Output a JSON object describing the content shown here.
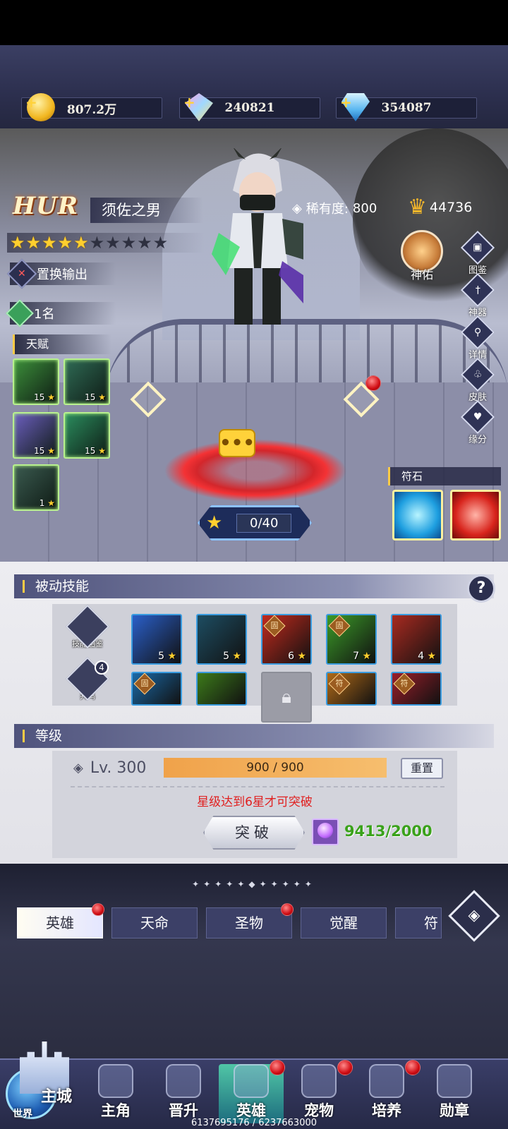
{
  "currency": {
    "gold": "807.2万",
    "crystal": "240821",
    "diamond": "354087"
  },
  "hero": {
    "rarity_grade": "HUR",
    "name": "须佐之男",
    "rarity_label": "稀有度:",
    "rarity_value": "800",
    "power": "44736",
    "stars_filled": 5,
    "stars_total": 10,
    "role": "置换输出",
    "rank": "1名",
    "talent_title": "天赋",
    "talents": [
      {
        "level": "15",
        "color": "#3c8f3a"
      },
      {
        "level": "15",
        "color": "#2f6b55"
      },
      {
        "level": "15",
        "color": "#6c5fbf"
      },
      {
        "level": "15",
        "color": "#2b8d5e"
      },
      {
        "level": "1",
        "color": "#3b5b50"
      }
    ],
    "exp": "0/40",
    "rune_title": "符石"
  },
  "side_buttons": [
    {
      "label": "神佑"
    },
    {
      "label": "图鉴"
    },
    {
      "label": "神器"
    },
    {
      "label": "详情"
    },
    {
      "label": "皮肤"
    },
    {
      "label": "缘分"
    }
  ],
  "passive": {
    "title": "被动技能",
    "help": "?",
    "tool_atlas": "技能图鉴",
    "tool_resonance": "共鸣",
    "resonance_count": "4",
    "skills_row1": [
      {
        "level": "5",
        "tag": "",
        "color": "#2a5fc9"
      },
      {
        "level": "5",
        "tag": "",
        "color": "#1d4d62"
      },
      {
        "level": "6",
        "tag": "固",
        "color": "#c22a1d"
      },
      {
        "level": "7",
        "tag": "固",
        "color": "#3b9a28"
      },
      {
        "level": "4",
        "tag": "",
        "color": "#a82a20"
      }
    ],
    "skills_row2": [
      {
        "tag": "固",
        "color": "#1a6aa8"
      },
      {
        "tag": "",
        "color": "#3c7a1a"
      },
      {
        "tag": "lock",
        "color": "#9b9ca6"
      },
      {
        "tag": "符",
        "color": "#b06a18"
      },
      {
        "tag": "符",
        "color": "#9a1e2a"
      }
    ]
  },
  "level": {
    "title": "等级",
    "label": "Lv. 300",
    "progress_text": "900 / 900",
    "progress": 1.0,
    "reset": "重置",
    "warning": "星级达到6星才可突破",
    "breakthrough": "突破",
    "material_count": "9413/2000"
  },
  "tabs": [
    "英雄",
    "天命",
    "圣物",
    "觉醒",
    "符文"
  ],
  "tab_more": "◈",
  "nav": {
    "main_city": "主城",
    "world": "世界",
    "items": [
      "主角",
      "晋升",
      "英雄",
      "宠物",
      "培养",
      "勋章"
    ]
  },
  "footer_id": "6137695176 / 6237663000"
}
